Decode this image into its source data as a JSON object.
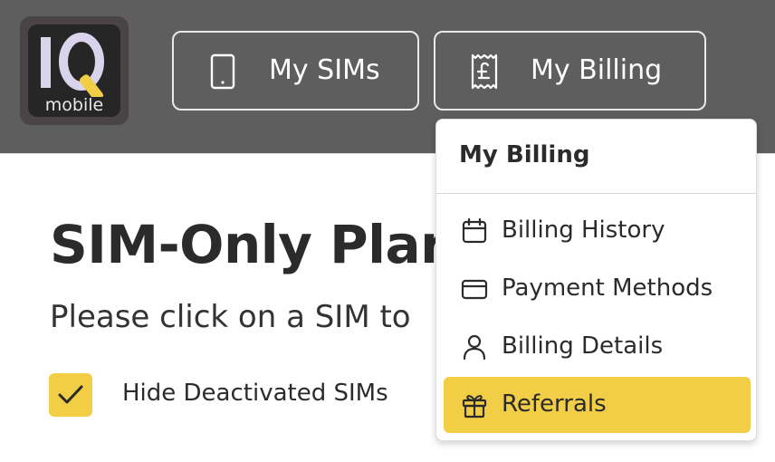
{
  "brand": {
    "logo_text": "mobile",
    "logo_letters": "IQ"
  },
  "nav": {
    "sims_label": "My SIMs",
    "sims_icon": "phone-icon",
    "billing_label": "My Billing",
    "billing_icon": "receipt-pound-icon"
  },
  "main": {
    "title": "SIM-Only Plar",
    "subtitle": "Please click on a SIM to",
    "hide_deactivated_label": "Hide Deactivated SIMs",
    "hide_deactivated_checked": true
  },
  "billing_menu": {
    "header": "My Billing",
    "items": [
      {
        "label": "Billing History",
        "icon": "calendar-icon",
        "active": false
      },
      {
        "label": "Payment Methods",
        "icon": "credit-card-icon",
        "active": false
      },
      {
        "label": "Billing Details",
        "icon": "user-icon",
        "active": false
      },
      {
        "label": "Referrals",
        "icon": "gift-icon",
        "active": true
      }
    ]
  },
  "colors": {
    "header_bg": "#5e5e5e",
    "accent": "#f2cd46",
    "text": "#2b2b2b"
  }
}
